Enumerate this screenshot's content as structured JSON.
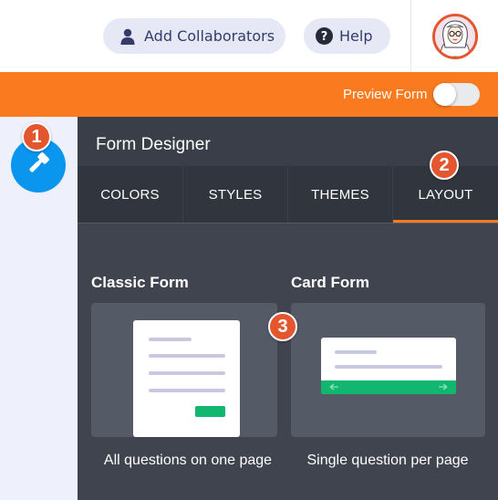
{
  "header": {
    "add_collaborators_label": "Add Collaborators",
    "help_label": "Help",
    "help_icon_glyph": "?",
    "icons": {
      "collab": "person-icon",
      "help": "question-circle-icon",
      "avatar": "user-avatar"
    }
  },
  "preview_bar": {
    "label": "Preview Form",
    "toggle_on": false
  },
  "callouts": [
    "1",
    "2",
    "3"
  ],
  "panel": {
    "title": "Form Designer",
    "tabs": [
      {
        "label": "COLORS",
        "active": false
      },
      {
        "label": "STYLES",
        "active": false
      },
      {
        "label": "THEMES",
        "active": false
      },
      {
        "label": "LAYOUT",
        "active": true
      }
    ],
    "layouts": [
      {
        "name": "Classic Form",
        "caption": "All questions on one page"
      },
      {
        "name": "Card Form",
        "caption": "Single question per page"
      }
    ]
  },
  "colors": {
    "accent_orange": "#f97a1f",
    "callout_red": "#e3562e",
    "brush_blue": "#0a95ef",
    "panel_bg": "#40444f",
    "submit_green": "#11b76f"
  }
}
